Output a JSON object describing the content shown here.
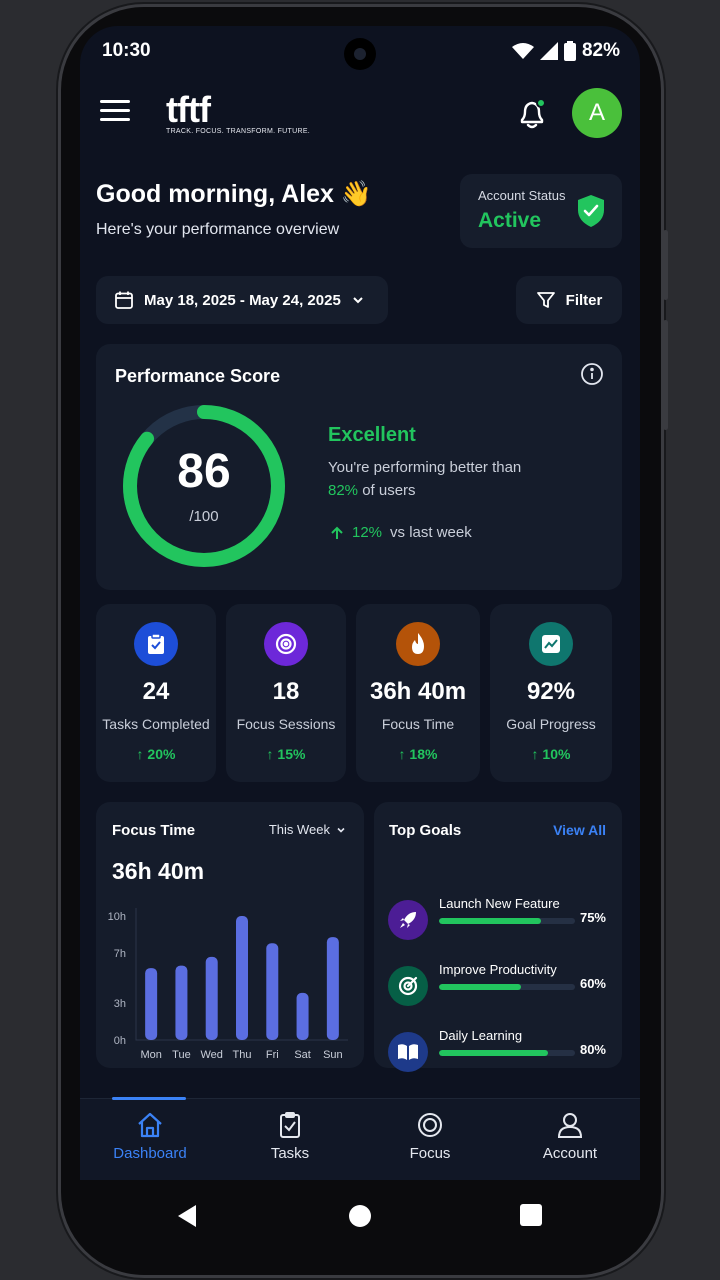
{
  "status_bar": {
    "time": "10:30",
    "battery": "82%"
  },
  "header": {
    "logo_word": "tftf",
    "logo_tagline": "TRACK. FOCUS. TRANSFORM. FUTURE.",
    "avatar_letter": "A"
  },
  "greeting": {
    "title": "Good morning, Alex 👋",
    "subtitle": "Here's your performance overview"
  },
  "account_status": {
    "label": "Account Status",
    "value": "Active"
  },
  "date_range": {
    "label": "May 18, 2025 - May 24, 2025"
  },
  "filter": {
    "label": "Filter"
  },
  "performance": {
    "title": "Performance Score",
    "score": "86",
    "out_of": "/100",
    "score_fraction": 0.86,
    "rating": "Excellent",
    "desc_prefix": "You're performing better than ",
    "desc_highlight": "82%",
    "desc_suffix": " of users",
    "trend_value": "12%",
    "trend_text": "vs last week"
  },
  "stats": [
    {
      "value": "24",
      "label": "Tasks Completed",
      "change": "20%",
      "icon": "clipboard-icon",
      "color": "#1d4ed8"
    },
    {
      "value": "18",
      "label": "Focus Sessions",
      "change": "15%",
      "icon": "target-icon",
      "color": "#6d28d9"
    },
    {
      "value": "36h 40m",
      "label": "Focus Time",
      "change": "18%",
      "icon": "flame-icon",
      "color": "#b45309"
    },
    {
      "value": "92%",
      "label": "Goal Progress",
      "change": "10%",
      "icon": "chart-icon",
      "color": "#0f766e"
    }
  ],
  "focus_time": {
    "title": "Focus Time",
    "period": "This Week",
    "total": "36h 40m"
  },
  "chart_data": {
    "type": "bar",
    "title": "Focus Time",
    "categories": [
      "Mon",
      "Tue",
      "Wed",
      "Thu",
      "Fri",
      "Sat",
      "Sun"
    ],
    "values": [
      5.8,
      6.0,
      6.7,
      10.0,
      7.8,
      3.8,
      8.3
    ],
    "yticks": [
      "10h",
      "7h",
      "3h",
      "0h"
    ],
    "ylim": [
      0,
      10
    ],
    "color": "#5b6ee1"
  },
  "top_goals": {
    "title": "Top Goals",
    "view_all": "View All",
    "items": [
      {
        "name": "Launch New Feature",
        "percent": "75%",
        "progress": 0.75,
        "icon": "rocket-icon",
        "color": "#4c1d95"
      },
      {
        "name": "Improve Productivity",
        "percent": "60%",
        "progress": 0.6,
        "icon": "target-icon",
        "color": "#065f46"
      },
      {
        "name": "Daily Learning",
        "percent": "80%",
        "progress": 0.8,
        "icon": "book-icon",
        "color": "#1e3a8a"
      }
    ]
  },
  "bottom_nav": [
    {
      "label": "Dashboard",
      "icon": "home-icon",
      "active": true
    },
    {
      "label": "Tasks",
      "icon": "clipboard-icon",
      "active": false
    },
    {
      "label": "Focus",
      "icon": "target-icon",
      "active": false
    },
    {
      "label": "Account",
      "icon": "user-icon",
      "active": false
    }
  ]
}
